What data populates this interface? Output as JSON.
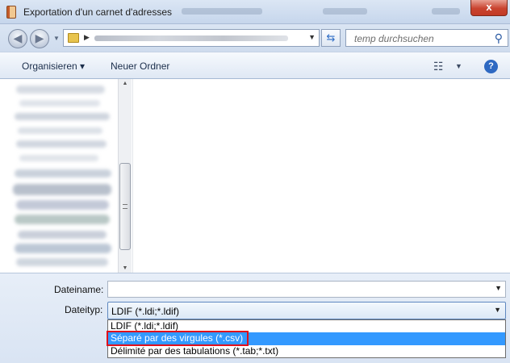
{
  "window": {
    "title": "Exportation d'un carnet d'adresses",
    "close_label": "x"
  },
  "navigation": {
    "back_glyph": "◀",
    "forward_glyph": "▶",
    "search_placeholder": "temp durchsuchen"
  },
  "toolbar": {
    "organize_label": "Organisieren ▾",
    "new_folder_label": "Neuer Ordner"
  },
  "form": {
    "filename_label": "Dateiname:",
    "filename_value": "",
    "filetype_label": "Dateityp:",
    "filetype_value": "LDIF (*.ldi;*.ldif)",
    "filetype_options": [
      "LDIF (*.ldi;*.ldif)",
      "Séparé par des virgules (*.csv)",
      "Délimité par des tabulations (*.tab;*.txt)"
    ],
    "selected_option_index": 1
  },
  "icons": {
    "app": "address-book-icon",
    "folder": "folder-icon",
    "refresh": "refresh-icon",
    "search": "search-icon",
    "views": "view-options-icon",
    "help": "help-icon"
  },
  "colors": {
    "selection": "#3399ff",
    "annotation_box": "#e1101b",
    "help_icon": "#2e69c2"
  }
}
